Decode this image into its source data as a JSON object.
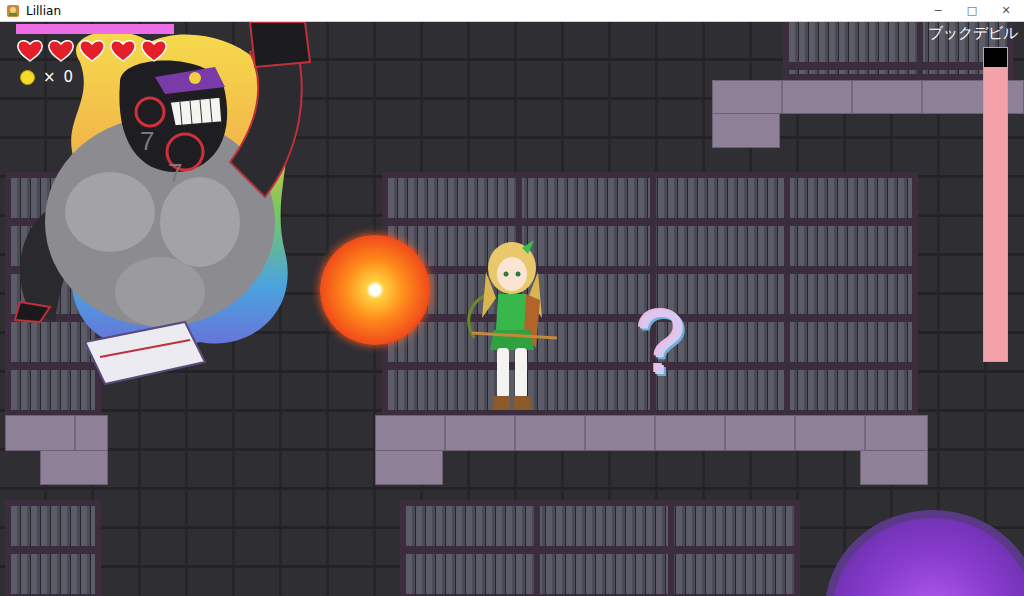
{
  "window": {
    "title": "Lillian",
    "controls": [
      "─",
      "□",
      "✕"
    ]
  },
  "hud": {
    "magic": {
      "level": 1
    },
    "hearts": [
      {
        "filled": true
      },
      {
        "filled": true
      },
      {
        "filled": true
      },
      {
        "filled": true
      },
      {
        "filled": true
      }
    ],
    "coins": {
      "symbol": "×",
      "count": "0"
    }
  },
  "boss": {
    "name": "ブックデビル",
    "hp": {
      "level": 0.94
    },
    "damage": [
      "7",
      "7"
    ]
  },
  "scene": {
    "hint": "?"
  }
}
